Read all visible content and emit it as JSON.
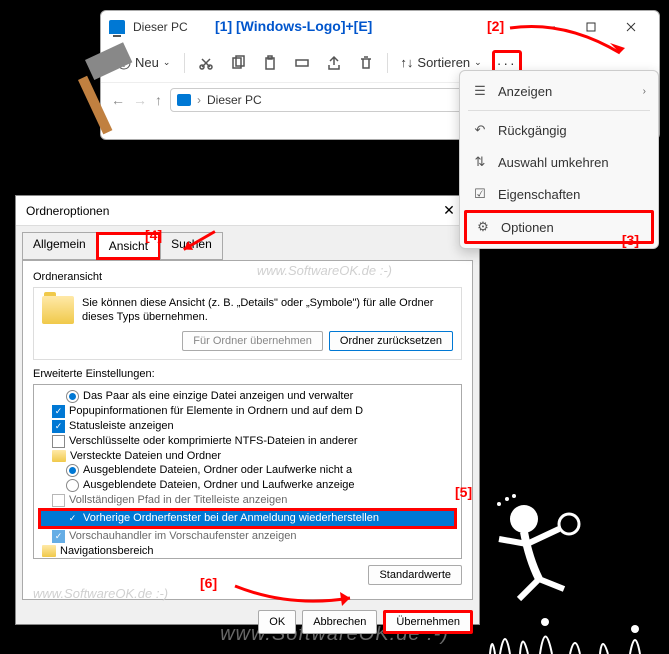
{
  "explorer": {
    "title": "Dieser PC",
    "neu_label": "Neu",
    "sort_label": "Sortieren",
    "breadcrumb": "Dieser PC"
  },
  "annotations": {
    "a1": "[1]  [Windows-Logo]+[E]",
    "a2": "[2]",
    "a3": "[3]",
    "a4": "[4]",
    "a5": "[5]",
    "a6": "[6]"
  },
  "dropdown": {
    "anzeigen": "Anzeigen",
    "rueckgaengig": "Rückgängig",
    "auswahl": "Auswahl umkehren",
    "eigenschaften": "Eigenschaften",
    "optionen": "Optionen"
  },
  "dialog": {
    "title": "Ordneroptionen",
    "tab_allgemein": "Allgemein",
    "tab_ansicht": "Ansicht",
    "tab_suchen": "Suchen",
    "section_title": "Ordneransicht",
    "desc": "Sie können diese Ansicht (z. B. „Details\" oder „Symbole\") für alle Ordner dieses Typs übernehmen.",
    "btn_apply_folders": "Für Ordner übernehmen",
    "btn_reset_folders": "Ordner zurücksetzen",
    "adv_title": "Erweiterte Einstellungen:",
    "tree": {
      "i1": "Das Paar als eine einzige Datei anzeigen und verwalter",
      "i2": "Popupinformationen für Elemente in Ordnern und auf dem D",
      "i3": "Statusleiste anzeigen",
      "i4": "Verschlüsselte oder komprimierte NTFS-Dateien in anderer",
      "i5": "Versteckte Dateien und Ordner",
      "i6": "Ausgeblendete Dateien, Ordner oder Laufwerke nicht a",
      "i7": "Ausgeblendete Dateien, Ordner und Laufwerke anzeige",
      "i8": "Vollständigen Pfad in der Titelleiste anzeigen",
      "i9": "Vorherige Ordnerfenster bei der Anmeldung wiederherstellen",
      "i10": "Vorschauhandler im Vorschaufenster anzeigen",
      "i11": "Navigationsbereich"
    },
    "btn_defaults": "Standardwerte",
    "btn_ok": "OK",
    "btn_cancel": "Abbrechen",
    "btn_apply": "Übernehmen"
  },
  "watermark": "www.SoftwareOK.de :-)"
}
